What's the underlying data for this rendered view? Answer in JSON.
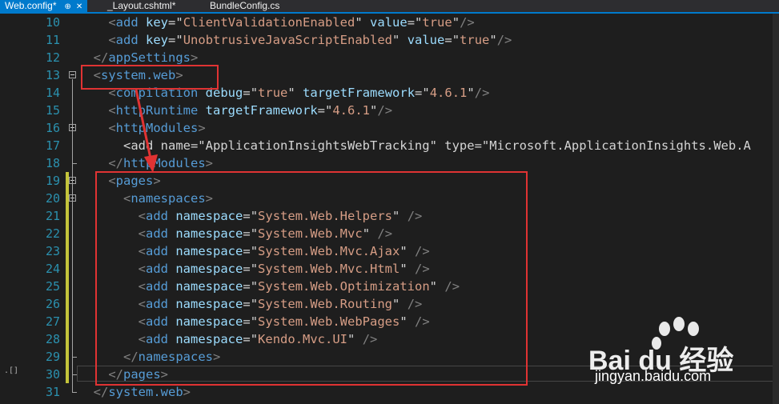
{
  "tabs": [
    {
      "label": "Web.config*",
      "active": true,
      "pin_icon": "pin-icon",
      "close_icon": "close-icon"
    },
    {
      "label": "_Layout.cshtml*",
      "active": false
    },
    {
      "label": "BundleConfig.cs",
      "active": false
    }
  ],
  "margin_marker": ".[]",
  "lines": [
    {
      "num": "10",
      "code": "    <add key=\"ClientValidationEnabled\" value=\"true\"/>"
    },
    {
      "num": "11",
      "code": "    <add key=\"UnobtrusiveJavaScriptEnabled\" value=\"true\"/>"
    },
    {
      "num": "12",
      "code": "  </appSettings>"
    },
    {
      "num": "13",
      "code": "  <system.web>"
    },
    {
      "num": "14",
      "code": "    <compilation debug=\"true\" targetFramework=\"4.6.1\"/>"
    },
    {
      "num": "15",
      "code": "    <httpRuntime targetFramework=\"4.6.1\"/>"
    },
    {
      "num": "16",
      "code": "    <httpModules>"
    },
    {
      "num": "17",
      "code": "      <add name=\"ApplicationInsightsWebTracking\" type=\"Microsoft.ApplicationInsights.Web.A"
    },
    {
      "num": "18",
      "code": "    </httpModules>"
    },
    {
      "num": "19",
      "code": "    <pages>"
    },
    {
      "num": "20",
      "code": "      <namespaces>"
    },
    {
      "num": "21",
      "code": "        <add namespace=\"System.Web.Helpers\" />"
    },
    {
      "num": "22",
      "code": "        <add namespace=\"System.Web.Mvc\" />"
    },
    {
      "num": "23",
      "code": "        <add namespace=\"System.Web.Mvc.Ajax\" />"
    },
    {
      "num": "24",
      "code": "        <add namespace=\"System.Web.Mvc.Html\" />"
    },
    {
      "num": "25",
      "code": "        <add namespace=\"System.Web.Optimization\" />"
    },
    {
      "num": "26",
      "code": "        <add namespace=\"System.Web.Routing\" />"
    },
    {
      "num": "27",
      "code": "        <add namespace=\"System.Web.WebPages\" />"
    },
    {
      "num": "28",
      "code": "        <add namespace=\"Kendo.Mvc.UI\" />"
    },
    {
      "num": "29",
      "code": "      </namespaces>"
    },
    {
      "num": "30",
      "code": "    </pages>"
    },
    {
      "num": "31",
      "code": "  </system.web>"
    }
  ],
  "watermark": {
    "logo": "Bai du 经验",
    "site": "jingyan.baidu.com"
  },
  "colors": {
    "accent": "#007acc",
    "annotation": "#e03333",
    "tag": "#569cd6",
    "attr": "#9cdcfe",
    "value": "#d69d85",
    "line_number": "#2b91af"
  }
}
